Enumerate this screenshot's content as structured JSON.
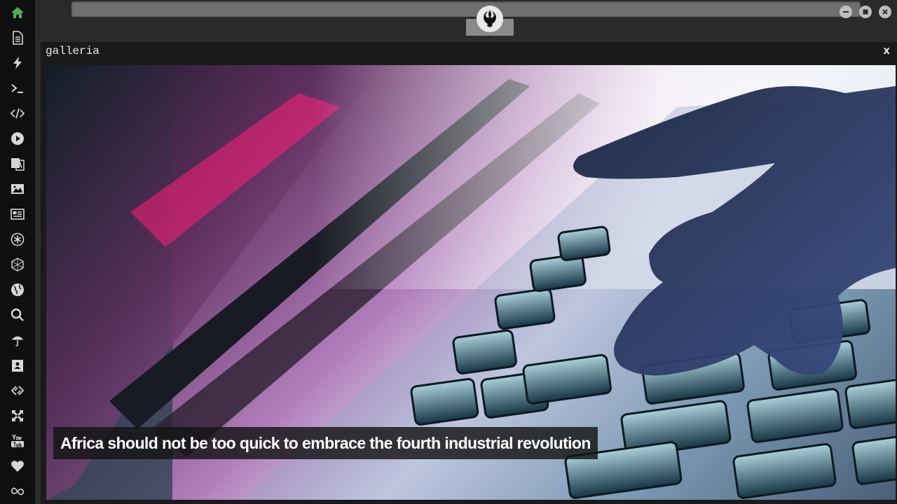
{
  "sidebar": {
    "items": [
      {
        "icon": "home-icon"
      },
      {
        "icon": "document-icon"
      },
      {
        "icon": "lightning-icon"
      },
      {
        "icon": "terminal-icon"
      },
      {
        "icon": "code-icon"
      },
      {
        "icon": "play-icon"
      },
      {
        "icon": "translate-icon"
      },
      {
        "icon": "image-icon"
      },
      {
        "icon": "newspaper-icon"
      },
      {
        "icon": "asterisk-icon"
      },
      {
        "icon": "hexagon-icon"
      },
      {
        "icon": "globe-icon"
      },
      {
        "icon": "search-icon"
      },
      {
        "icon": "umbrella-icon"
      },
      {
        "icon": "contact-card-icon"
      },
      {
        "icon": "connect-icon"
      },
      {
        "icon": "expand-icon"
      },
      {
        "icon": "youtube-icon"
      },
      {
        "icon": "heart-icon"
      },
      {
        "icon": "infinity-icon"
      }
    ],
    "active_color": "#4caf50"
  },
  "window": {
    "logo_icon": "rebel-alliance-icon",
    "buttons": [
      "minimize-icon",
      "maximize-icon",
      "close-icon"
    ]
  },
  "panel": {
    "title": "galleria",
    "close_label": "x",
    "caption": "Africa should not be too quick to embrace the fourth industrial revolution"
  }
}
